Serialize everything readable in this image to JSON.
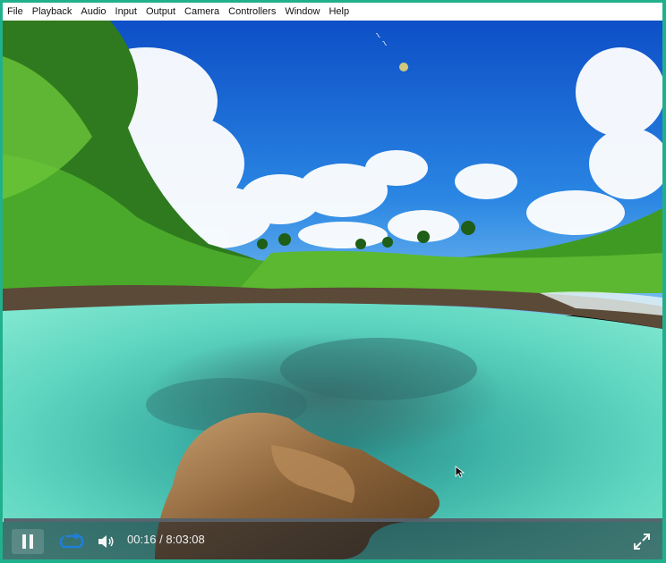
{
  "menubar": {
    "items": [
      "File",
      "Playback",
      "Audio",
      "Input",
      "Output",
      "Camera",
      "Controllers",
      "Window",
      "Help"
    ]
  },
  "player": {
    "current_time": "00:16",
    "separator": " / ",
    "duration": "8:03:08",
    "progress": 0.0006
  },
  "icons": {
    "pause": "pause-icon",
    "loop": "loop-icon",
    "volume": "volume-icon",
    "fullscreen": "fullscreen-icon"
  },
  "colors": {
    "window_border": "#21b08c",
    "loop_accent": "#1e7fd8",
    "sky": "#1f6fd6",
    "water": "#3cc6ae"
  }
}
